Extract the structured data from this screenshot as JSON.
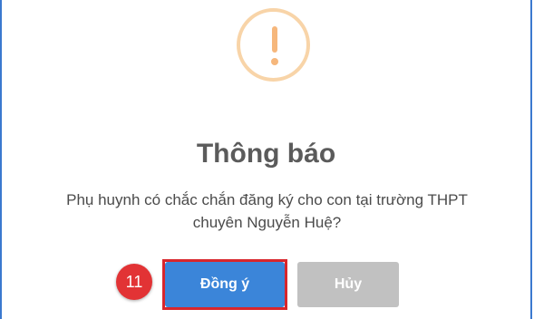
{
  "dialog": {
    "icon": "warning-exclamation-icon",
    "title": "Thông báo",
    "message_lines": [
      "Phụ huynh có chắc chắn đăng ký cho con tại trường THPT",
      "chuyên Nguyễn Huệ?"
    ],
    "step_badge": "11",
    "ok_label": "Đồng ý",
    "cancel_label": "Hủy"
  },
  "colors": {
    "frame_border": "#3b79cf",
    "warning_icon": "#f6b77c",
    "ok_button": "#3b85d9",
    "cancel_button": "#c1c1c1",
    "step_badge": "#e23335",
    "highlight_border": "#d8262c"
  }
}
